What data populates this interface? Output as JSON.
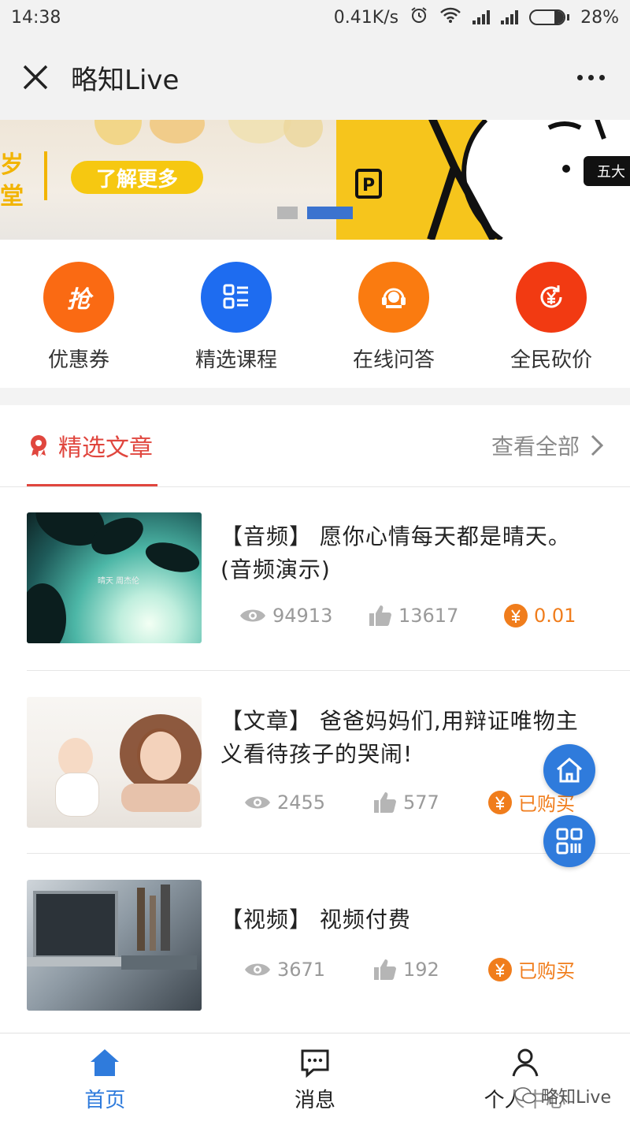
{
  "status_bar": {
    "time": "14:38",
    "speed": "0.41K/s",
    "battery": "28%",
    "battery_level": 0.28
  },
  "app_bar": {
    "title": "略知Live"
  },
  "banner": {
    "left_text": "岁\n堂",
    "cta": "了解更多",
    "tag": "五大",
    "active_slide": 2,
    "slide_count": 2
  },
  "quick_menu": [
    {
      "label": "优惠券",
      "glyph": "抢",
      "color": "#fa6a13"
    },
    {
      "label": "精选课程",
      "glyph": "",
      "color": "#1e6cf0"
    },
    {
      "label": "在线问答",
      "glyph": "",
      "color": "#fa7b10"
    },
    {
      "label": "全民砍价",
      "glyph": "",
      "color": "#f23a12"
    }
  ],
  "section": {
    "title": "精选文章",
    "view_all": "查看全部"
  },
  "articles": [
    {
      "title": "【音频】 愿你心情每天都是晴天。(音频演示)",
      "views": "94913",
      "likes": "13617",
      "price": "0.01",
      "thumb_caption": "晴天  周杰伦"
    },
    {
      "title": "【文章】 爸爸妈妈们,用辩证唯物主义看待孩子的哭闹!",
      "views": "2455",
      "likes": "577",
      "price": "已购买"
    },
    {
      "title": "【视频】 视频付费",
      "views": "3671",
      "likes": "192",
      "price": "已购买"
    }
  ],
  "tabs": [
    {
      "label": "首页",
      "active": true
    },
    {
      "label": "消息",
      "active": false
    },
    {
      "label": "个人中心",
      "active": false
    }
  ],
  "watermark": "略知Live",
  "colors": {
    "accent": "#2f7bdc",
    "section_red": "#e0463e",
    "price_orange": "#f07d1c"
  }
}
